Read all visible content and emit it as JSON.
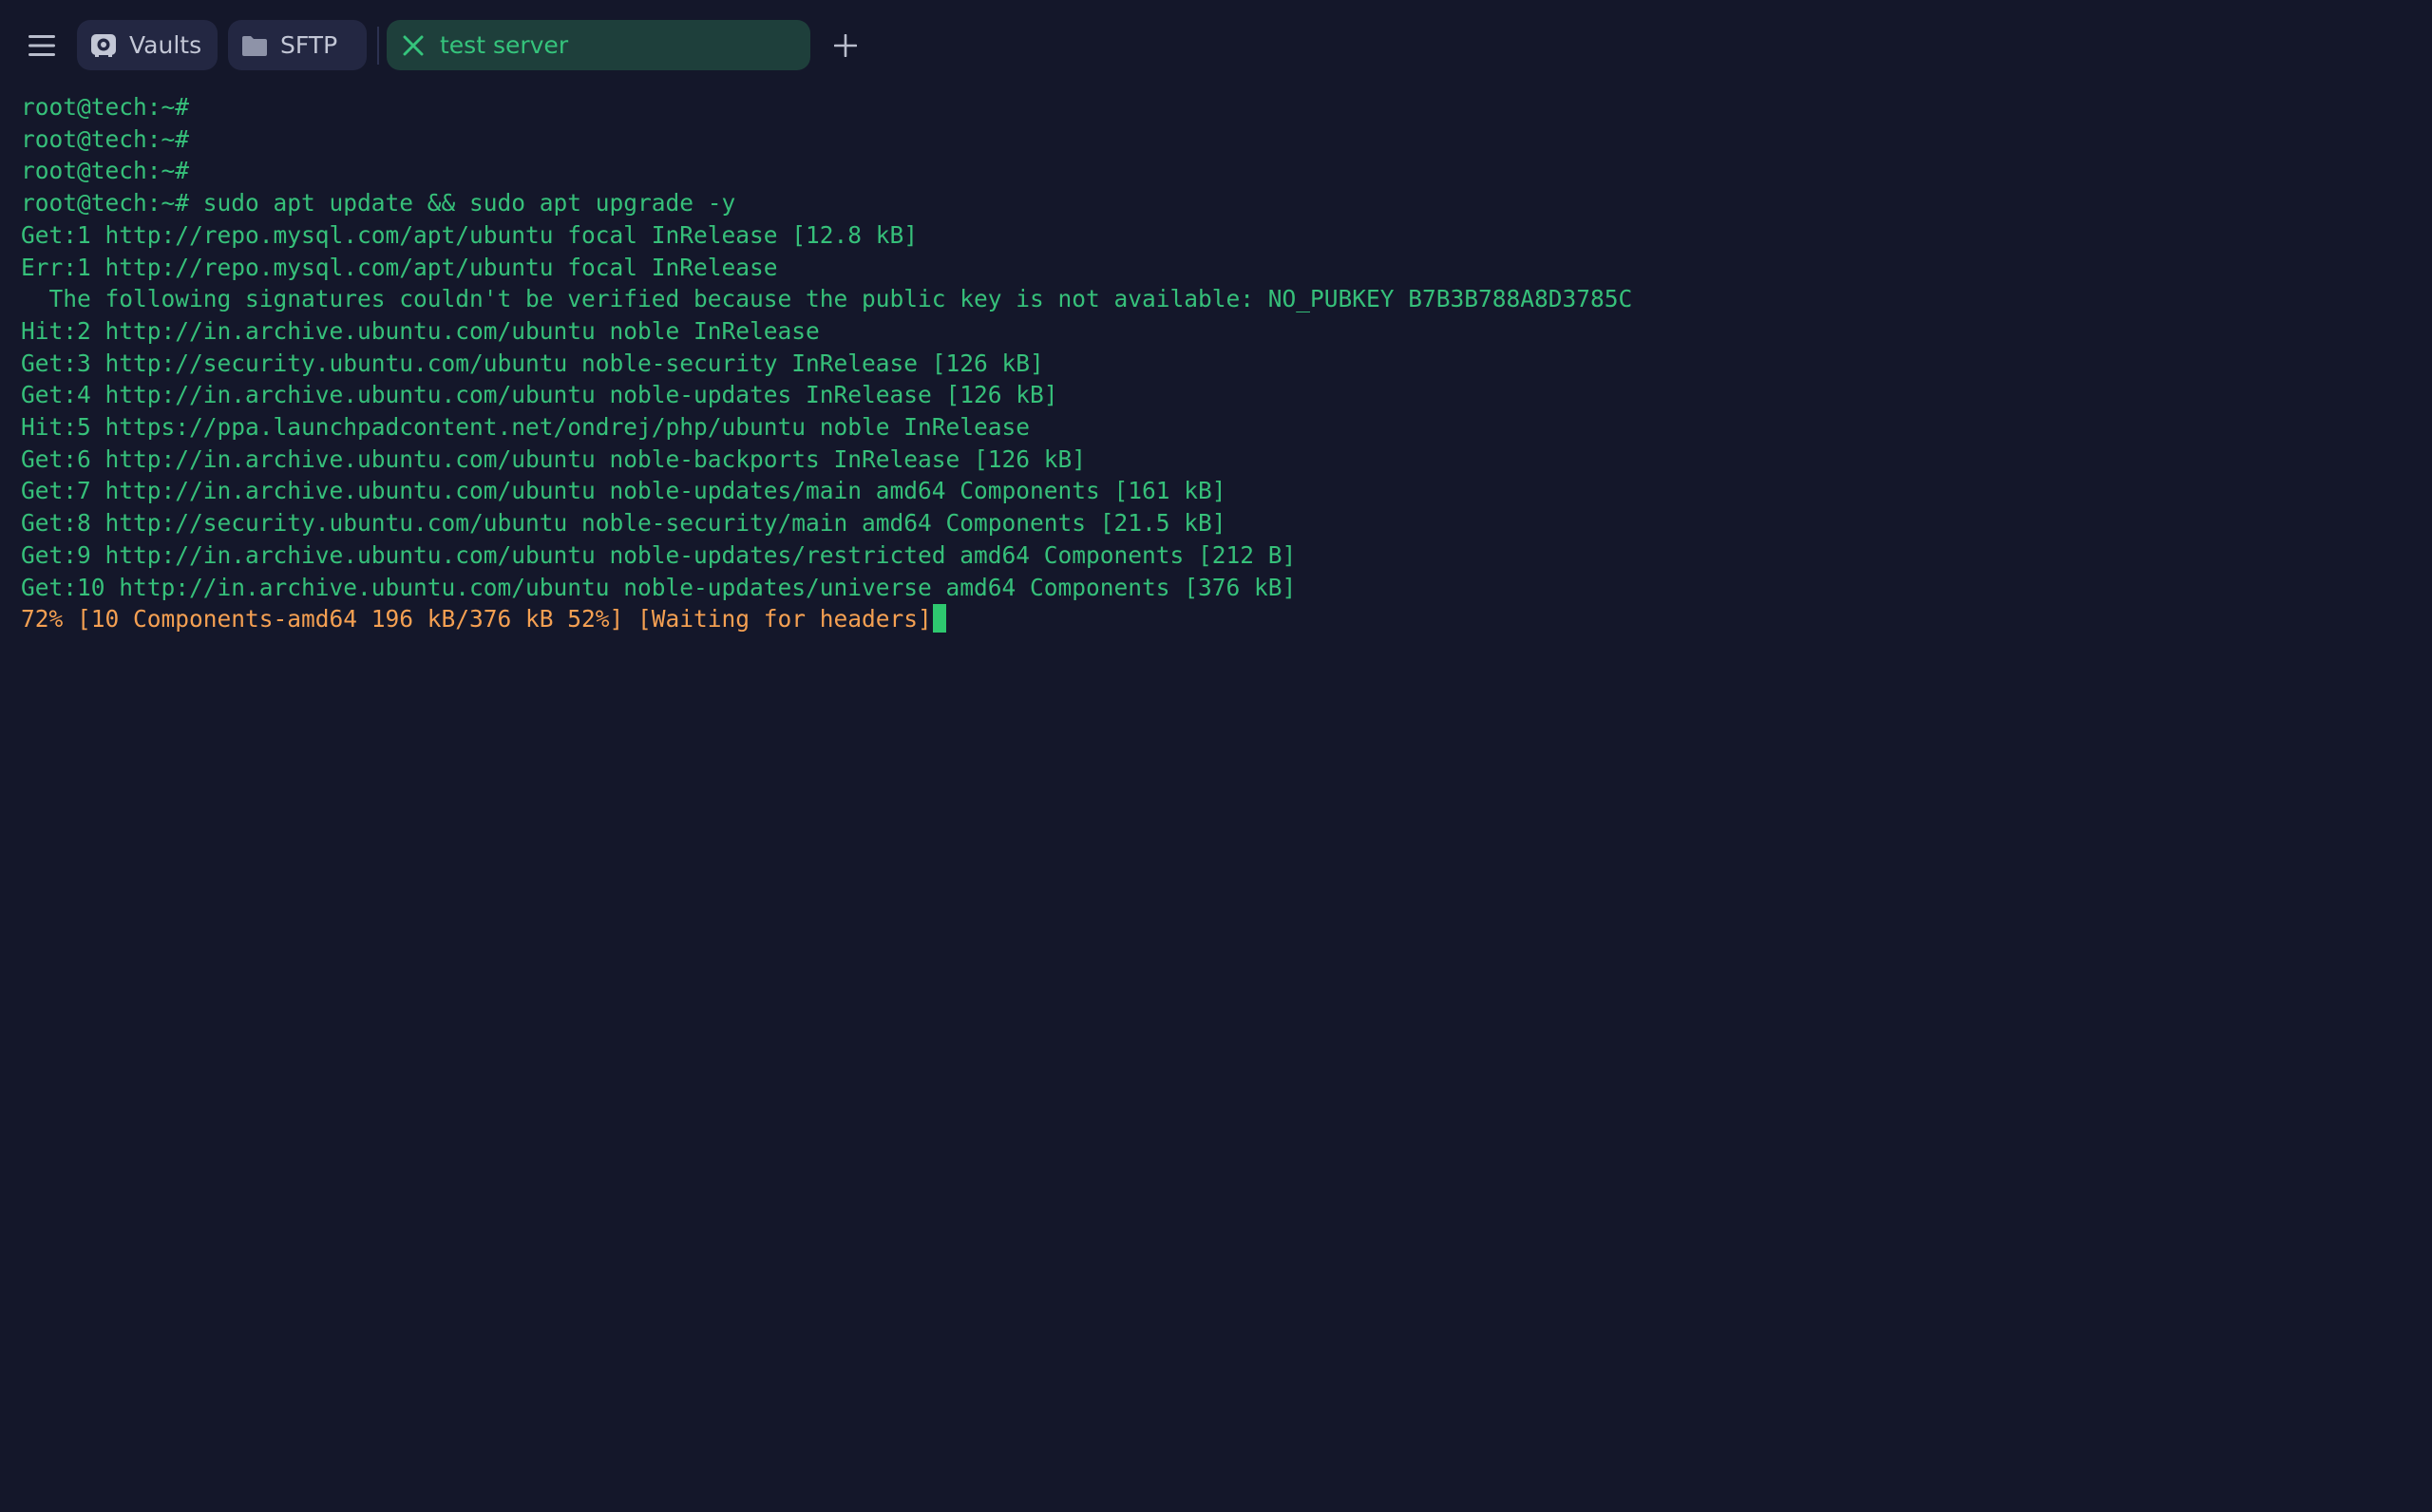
{
  "topbar": {
    "menu_icon": "hamburger-menu-icon",
    "tabs": [
      {
        "label": "Vaults",
        "icon": "vault-icon"
      },
      {
        "label": "SFTP",
        "icon": "folder-icon"
      },
      {
        "label": "test server",
        "icon": "close-x-icon",
        "active": true
      }
    ],
    "add_icon": "plus-icon"
  },
  "terminal": {
    "lines": [
      "root@tech:~#",
      "root@tech:~#",
      "root@tech:~#",
      "root@tech:~# sudo apt update && sudo apt upgrade -y",
      "Get:1 http://repo.mysql.com/apt/ubuntu focal InRelease [12.8 kB]",
      "Err:1 http://repo.mysql.com/apt/ubuntu focal InRelease",
      "  The following signatures couldn't be verified because the public key is not available: NO_PUBKEY B7B3B788A8D3785C",
      "Hit:2 http://in.archive.ubuntu.com/ubuntu noble InRelease",
      "Get:3 http://security.ubuntu.com/ubuntu noble-security InRelease [126 kB]",
      "Get:4 http://in.archive.ubuntu.com/ubuntu noble-updates InRelease [126 kB]",
      "Hit:5 https://ppa.launchpadcontent.net/ondrej/php/ubuntu noble InRelease",
      "Get:6 http://in.archive.ubuntu.com/ubuntu noble-backports InRelease [126 kB]",
      "Get:7 http://in.archive.ubuntu.com/ubuntu noble-updates/main amd64 Components [161 kB]",
      "Get:8 http://security.ubuntu.com/ubuntu noble-security/main amd64 Components [21.5 kB]",
      "Get:9 http://in.archive.ubuntu.com/ubuntu noble-updates/restricted amd64 Components [212 B]",
      "Get:10 http://in.archive.ubuntu.com/ubuntu noble-updates/universe amd64 Components [376 kB]"
    ],
    "progress_line": "72% [10 Components-amd64 196 kB/376 kB 52%] [Waiting for headers]"
  },
  "colors": {
    "background": "#14172a",
    "tab_bg": "#232742",
    "active_tab_bg": "#1e3f3b",
    "terminal_text": "#36c07a",
    "progress_text": "#f5a052",
    "cursor": "#2ec86f"
  }
}
